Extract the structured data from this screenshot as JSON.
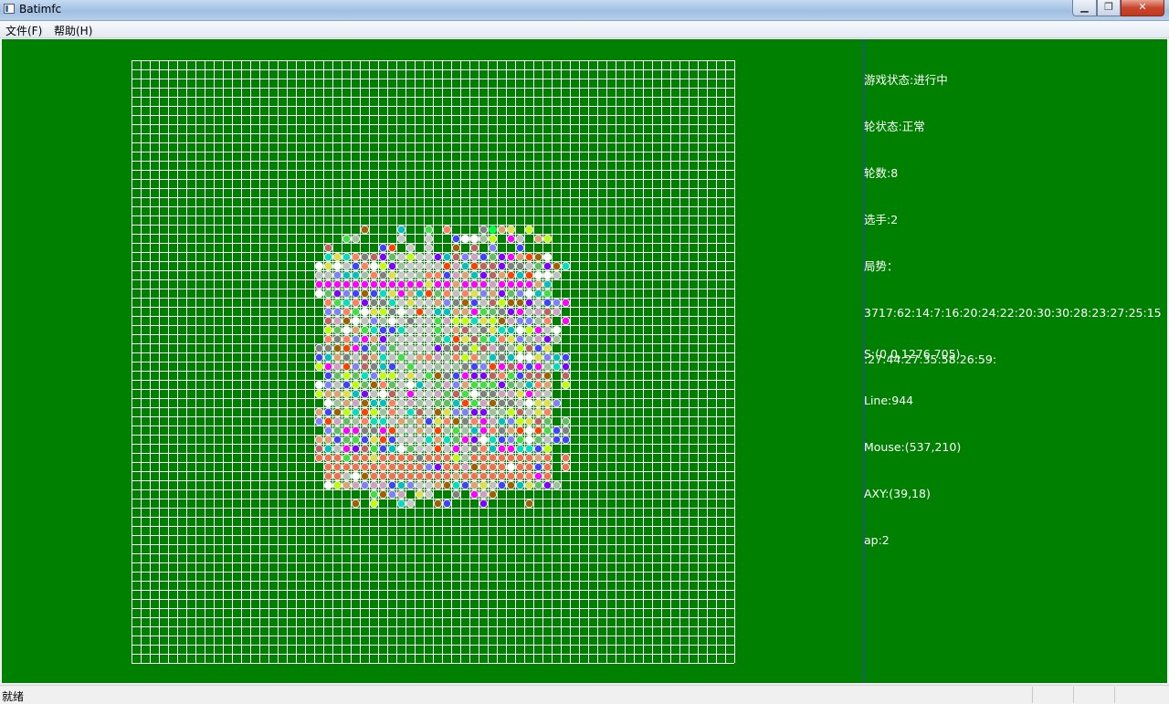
{
  "window": {
    "title": "Batimfc",
    "min_glyph": "▁",
    "max_glyph": "❐",
    "close_glyph": "✕"
  },
  "menu": {
    "file": "文件(F)",
    "help": "帮助(H)"
  },
  "info": {
    "lines": [
      "游戏状态:进行中",
      "轮状态:正常",
      "轮数:8",
      "选手:2",
      "局势：",
      "3717:62:14:7:16:20:24:22:20:30:30:28:23:27:25:15",
      ":27:44:27:35:58:26:59:"
    ]
  },
  "debug": {
    "lines": [
      "S:(0,0,1276,705)",
      "Line:944",
      "Mouse:(537,210)",
      "AXY:(39,18)",
      "ap:2"
    ]
  },
  "status": {
    "text": "就绪"
  },
  "board": {
    "background": "#008000",
    "grid_color": "#ffffff",
    "cols": 66,
    "rows": 66,
    "cursor_cell": {
      "col": 39,
      "row": 18,
      "color": "#00ff40"
    },
    "palette": [
      "#ff00ff",
      "#00e0c0",
      "#c0c0c0",
      "#40e040",
      "#ff8060",
      "#e0a070",
      "#8000ff",
      "#a0c0a0",
      "#c0ff00",
      "#808080",
      "#ff4000",
      "#4040ff",
      "#a06000",
      "#ffffff",
      "#00c0c0",
      "#8080ff",
      "#c06060",
      "#60c060",
      "#e0e040",
      "#d0a0c0"
    ]
  }
}
